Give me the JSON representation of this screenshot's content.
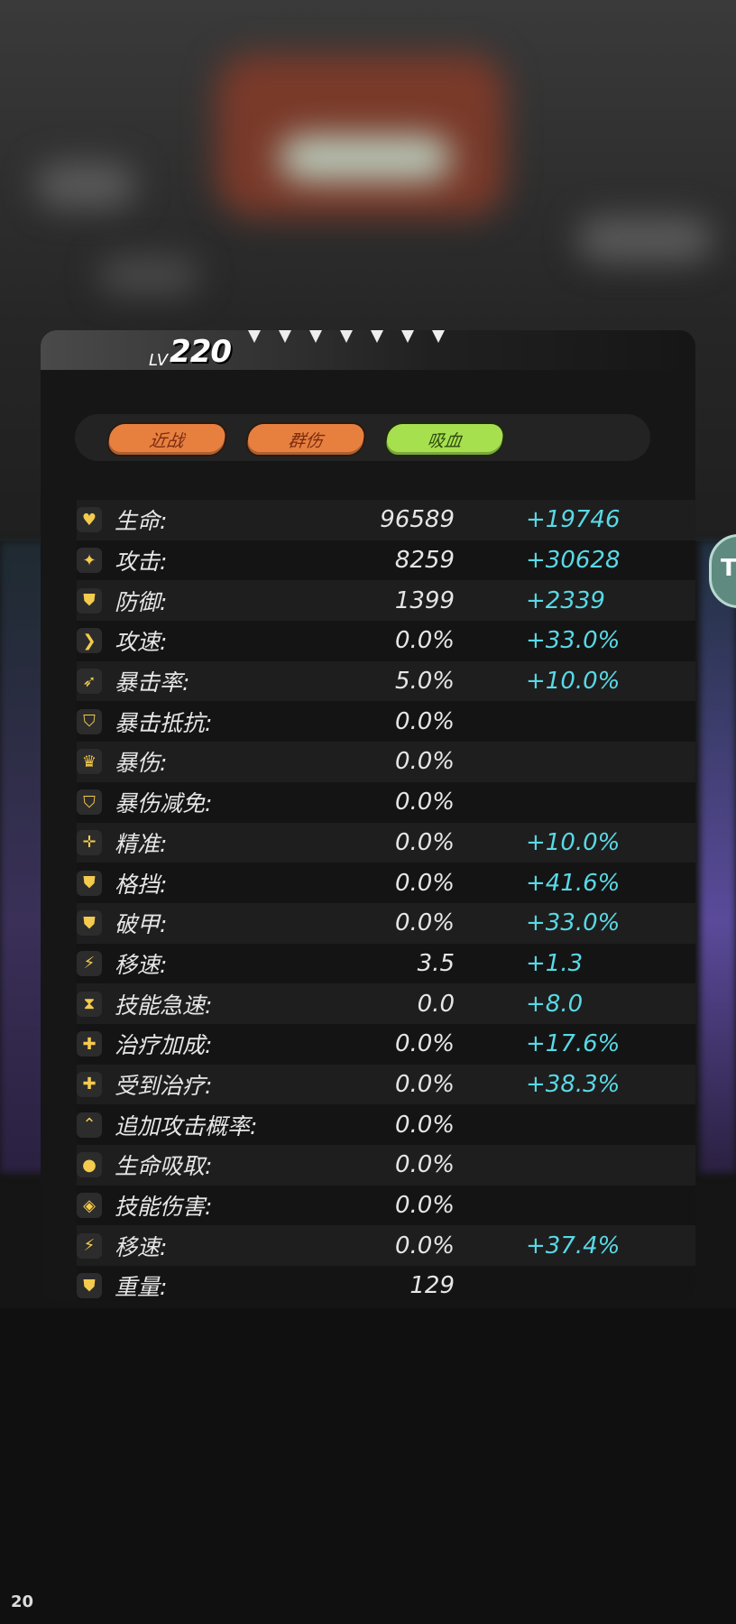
{
  "hero": {
    "level_prefix": "LV",
    "level": "220"
  },
  "tags": [
    {
      "label": "近战",
      "color": "#e7803f"
    },
    {
      "label": "群伤",
      "color": "#e7803f"
    },
    {
      "label": "吸血",
      "color": "#a6e04f"
    }
  ],
  "stats": [
    {
      "icon": "heart-icon",
      "label": "生命:",
      "value": "96589",
      "bonus": "+19746"
    },
    {
      "icon": "sparkle-icon",
      "label": "攻击:",
      "value": "8259",
      "bonus": "+30628"
    },
    {
      "icon": "shield-icon",
      "label": "防御:",
      "value": "1399",
      "bonus": "+2339"
    },
    {
      "icon": "chevron-right-icon",
      "label": "攻速:",
      "value": "0.0%",
      "bonus": "+33.0%"
    },
    {
      "icon": "feather-icon",
      "label": "暴击率:",
      "value": "5.0%",
      "bonus": "+10.0%"
    },
    {
      "icon": "shield-outline-icon",
      "label": "暴击抵抗:",
      "value": "0.0%",
      "bonus": ""
    },
    {
      "icon": "crown-icon",
      "label": "暴伤:",
      "value": "0.0%",
      "bonus": ""
    },
    {
      "icon": "shield-crack-icon",
      "label": "暴伤减免:",
      "value": "0.0%",
      "bonus": ""
    },
    {
      "icon": "crosshair-icon",
      "label": "精准:",
      "value": "0.0%",
      "bonus": "+10.0%"
    },
    {
      "icon": "shield-bolt-icon",
      "label": "格挡:",
      "value": "0.0%",
      "bonus": "+41.6%"
    },
    {
      "icon": "armor-break-icon",
      "label": "破甲:",
      "value": "0.0%",
      "bonus": "+33.0%"
    },
    {
      "icon": "lightning-icon",
      "label": "移速:",
      "value": "3.5",
      "bonus": "+1.3"
    },
    {
      "icon": "hourglass-icon",
      "label": "技能急速:",
      "value": "0.0",
      "bonus": "+8.0"
    },
    {
      "icon": "plus-icon",
      "label": "治疗加成:",
      "value": "0.0%",
      "bonus": "+17.6%"
    },
    {
      "icon": "plus-icon",
      "label": "受到治疗:",
      "value": "0.0%",
      "bonus": "+38.3%"
    },
    {
      "icon": "double-chevron-up-icon",
      "label": "追加攻击概率:",
      "value": "0.0%",
      "bonus": ""
    },
    {
      "icon": "blood-drop-icon",
      "label": "生命吸取:",
      "value": "0.0%",
      "bonus": ""
    },
    {
      "icon": "target-icon",
      "label": "技能伤害:",
      "value": "0.0%",
      "bonus": ""
    },
    {
      "icon": "lightning-icon",
      "label": "移速:",
      "value": "0.0%",
      "bonus": "+37.4%"
    },
    {
      "icon": "shield-icon",
      "label": "重量:",
      "value": "129",
      "bonus": ""
    }
  ],
  "corner_number": "20",
  "side_badge": "T"
}
